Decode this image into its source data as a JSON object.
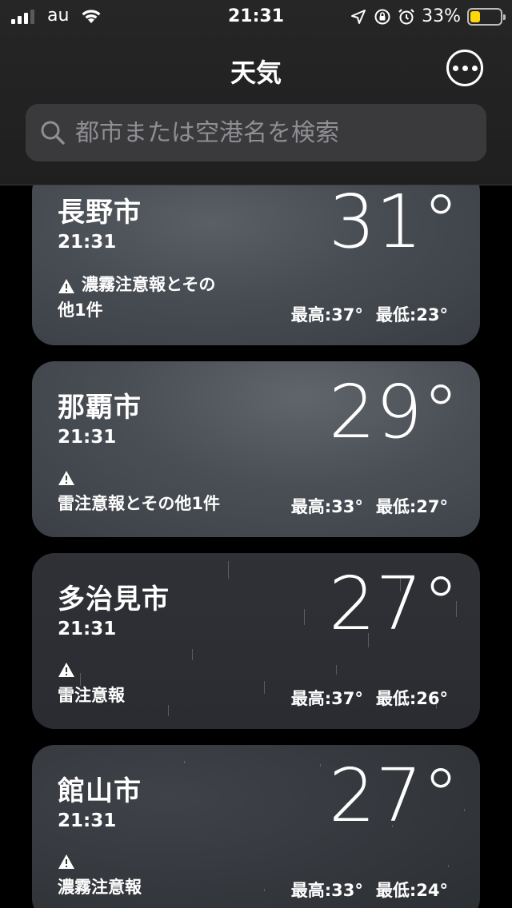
{
  "status_bar": {
    "carrier": "au",
    "time": "21:31",
    "battery_percent": "33%",
    "battery_level": 0.33,
    "battery_color": "#ffd60a"
  },
  "nav": {
    "title": "天気",
    "more_icon": "ellipsis-circle-icon"
  },
  "search": {
    "placeholder": "都市または空港名を検索",
    "icon": "magnifying-glass-icon"
  },
  "cities": [
    {
      "name": "長野市",
      "time": "21:31",
      "temp": "31°",
      "alert_line1": "濃霧注意報とその",
      "alert_line2": "他1件",
      "high": "最高:37°",
      "low": "最低:23°",
      "condition": "cloudy"
    },
    {
      "name": "那覇市",
      "time": "21:31",
      "temp": "29°",
      "alert": "雷注意報とその他1件",
      "high": "最高:33°",
      "low": "最低:27°",
      "condition": "cloudy"
    },
    {
      "name": "多治見市",
      "time": "21:31",
      "temp": "27°",
      "alert": "雷注意報",
      "high": "最高:37°",
      "low": "最低:26°",
      "condition": "rain"
    },
    {
      "name": "館山市",
      "time": "21:31",
      "temp": "27°",
      "alert": "濃霧注意報",
      "high": "最高:33°",
      "low": "最低:24°",
      "condition": "rain"
    }
  ]
}
